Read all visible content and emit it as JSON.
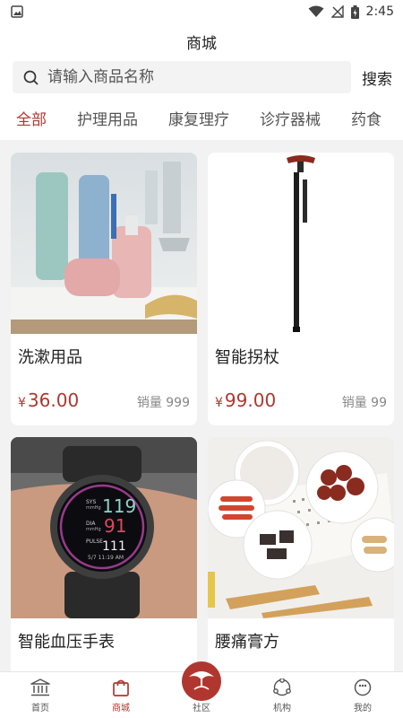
{
  "status_bar": {
    "time": "2:45"
  },
  "header": {
    "title": "商城"
  },
  "search": {
    "placeholder": "请输入商品名称",
    "button_label": "搜索"
  },
  "tabs": [
    "全部",
    "护理用品",
    "康复理疗",
    "诊疗器械",
    "药食"
  ],
  "active_tab": 0,
  "products": [
    {
      "name": "洗漱用品",
      "currency": "¥",
      "price": "36.00",
      "sales": "销量 999"
    },
    {
      "name": "智能拐杖",
      "currency": "¥",
      "price": "99.00",
      "sales": "销量 99"
    },
    {
      "name": "智能血压手表",
      "currency": "",
      "price": "",
      "sales": ""
    },
    {
      "name": "腰痛膏方",
      "currency": "",
      "price": "",
      "sales": ""
    }
  ],
  "watch_display": {
    "sys": "119",
    "dia": "91",
    "pulse": "111",
    "sys_label": "SYS mmHg",
    "dia_label": "DIA mmHg",
    "pulse_label": "PULSE /min",
    "date": "5/7 11:19 AM"
  },
  "bottom_nav": [
    {
      "label": "首页",
      "icon": "bank-icon"
    },
    {
      "label": "商城",
      "icon": "shopping-bag-icon"
    },
    {
      "label": "社区",
      "icon": "crane-logo-icon"
    },
    {
      "label": "机构",
      "icon": "network-icon"
    },
    {
      "label": "我的",
      "icon": "smiley-icon"
    }
  ],
  "colors": {
    "accent": "#b0372f",
    "background": "#f2f2f2"
  }
}
